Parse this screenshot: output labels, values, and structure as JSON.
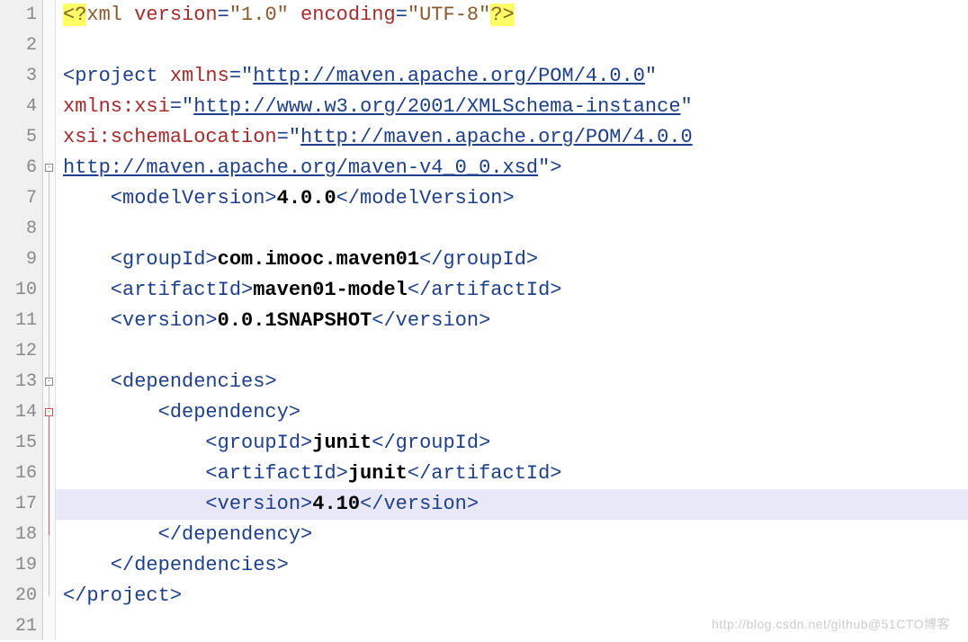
{
  "lineCount": 21,
  "highlightedLine": 17,
  "watermark": "http://blog.csdn.net/github@51CTO博客",
  "fold": [
    {
      "line": 6,
      "type": "box"
    },
    {
      "line": 13,
      "type": "box"
    },
    {
      "line": 14,
      "type": "box-red"
    }
  ],
  "foldLines": [
    {
      "from": 6,
      "to": 20,
      "red": false
    },
    {
      "from": 14,
      "to": 18,
      "red": true
    }
  ],
  "code": {
    "l1_a": "<?",
    "l1_b": "xml ",
    "l1_c": "version",
    "l1_d": "=",
    "l1_e": "\"1.0\"",
    "l1_f": " encoding",
    "l1_g": "=",
    "l1_h": "\"UTF-8\"",
    "l1_i": "?>",
    "l3_a": "<project ",
    "l3_b": "xmlns",
    "l3_c": "=\"",
    "l3_d": "http://maven.apache.org/POM/4.0.0",
    "l3_e": "\"",
    "l4_a": "xmlns:xsi",
    "l4_b": "=\"",
    "l4_c": "http://www.w3.org/2001/XMLSchema-instance",
    "l4_d": "\"",
    "l5_a": "xsi:schemaLocation",
    "l5_b": "=\"",
    "l5_c": "http://maven.apache.org/POM/4.0.0",
    "l6_a": "http://maven.apache.org/maven-v4_0_0.xsd",
    "l6_b": "\">",
    "l7_a": "    <modelVersion>",
    "l7_b": "4.0.0",
    "l7_c": "</modelVersion>",
    "l9_a": "    <groupId>",
    "l9_b": "com.imooc.maven01",
    "l9_c": "</groupId>",
    "l10_a": "    <artifactId>",
    "l10_b": "maven01-model",
    "l10_c": "</artifactId>",
    "l11_a": "    <version>",
    "l11_b": "0.0.1SNAPSHOT",
    "l11_c": "</version>",
    "l13_a": "    <dependencies>",
    "l14_a": "        <dependency>",
    "l15_a": "            <groupId>",
    "l15_b": "junit",
    "l15_c": "</groupId>",
    "l16_a": "            <artifactId>",
    "l16_b": "junit",
    "l16_c": "</artifactId>",
    "l17_a": "            <version>",
    "l17_b": "4.10",
    "l17_c": "</version>",
    "l18_a": "        </dependency>",
    "l19_a": "    </dependencies>",
    "l20_a": "</project>"
  }
}
